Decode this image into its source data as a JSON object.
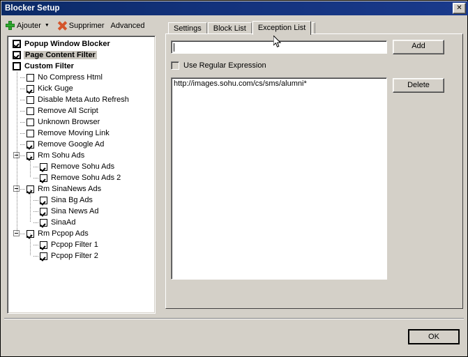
{
  "window": {
    "title": "Blocker Setup",
    "close_label": "✕"
  },
  "toolbar": {
    "add_label": "Ajouter",
    "add_caret": "▼",
    "remove_label": "Supprimer",
    "advanced_label": "Advanced"
  },
  "tree": {
    "nodes": [
      {
        "label": "Popup Window Blocker",
        "level": 0,
        "checked": true,
        "bold": true,
        "selected": false,
        "expander": false
      },
      {
        "label": "Page Content Filter",
        "level": 0,
        "checked": true,
        "bold": true,
        "selected": true,
        "expander": false
      },
      {
        "label": "Custom Filter",
        "level": 0,
        "checked": false,
        "bold": true,
        "selected": false,
        "expander": false
      },
      {
        "label": "No Compress Html",
        "level": 1,
        "checked": false,
        "bold": false,
        "selected": false,
        "expander": false
      },
      {
        "label": "Kick Guge",
        "level": 1,
        "checked": true,
        "bold": false,
        "selected": false,
        "expander": false
      },
      {
        "label": "Disable Meta Auto Refresh",
        "level": 1,
        "checked": false,
        "bold": false,
        "selected": false,
        "expander": false
      },
      {
        "label": "Remove All Script",
        "level": 1,
        "checked": false,
        "bold": false,
        "selected": false,
        "expander": false
      },
      {
        "label": "Unknown Browser",
        "level": 1,
        "checked": false,
        "bold": false,
        "selected": false,
        "expander": false
      },
      {
        "label": "Remove Moving Link",
        "level": 1,
        "checked": false,
        "bold": false,
        "selected": false,
        "expander": false
      },
      {
        "label": "Remove Google Ad",
        "level": 1,
        "checked": true,
        "bold": false,
        "selected": false,
        "expander": false
      },
      {
        "label": "Rm Sohu Ads",
        "level": 1,
        "checked": true,
        "bold": false,
        "selected": false,
        "expander": true
      },
      {
        "label": "Remove Sohu Ads",
        "level": 2,
        "checked": true,
        "bold": false,
        "selected": false,
        "expander": false
      },
      {
        "label": "Remove Sohu Ads 2",
        "level": 2,
        "checked": true,
        "bold": false,
        "selected": false,
        "expander": false
      },
      {
        "label": "Rm SinaNews Ads",
        "level": 1,
        "checked": true,
        "bold": false,
        "selected": false,
        "expander": true
      },
      {
        "label": "Sina Bg Ads",
        "level": 2,
        "checked": true,
        "bold": false,
        "selected": false,
        "expander": false
      },
      {
        "label": "Sina News Ad",
        "level": 2,
        "checked": true,
        "bold": false,
        "selected": false,
        "expander": false
      },
      {
        "label": "SinaAd",
        "level": 2,
        "checked": true,
        "bold": false,
        "selected": false,
        "expander": false
      },
      {
        "label": "Rm Pcpop Ads",
        "level": 1,
        "checked": true,
        "bold": false,
        "selected": false,
        "expander": true
      },
      {
        "label": "Pcpop Filter 1",
        "level": 2,
        "checked": true,
        "bold": false,
        "selected": false,
        "expander": false
      },
      {
        "label": "Pcpop Filter 2",
        "level": 2,
        "checked": true,
        "bold": false,
        "selected": false,
        "expander": false
      }
    ]
  },
  "tabs": [
    {
      "label": "Settings",
      "active": false
    },
    {
      "label": "Block List",
      "active": false
    },
    {
      "label": "Exception List",
      "active": true
    }
  ],
  "exception_panel": {
    "url_input_value": "",
    "url_input_placeholder": "",
    "add_label": "Add",
    "delete_label": "Delete",
    "regex_label": "Use Regular Expression",
    "regex_checked": false,
    "items": [
      "http://images.sohu.com/cs/sms/alumni*"
    ]
  },
  "footer": {
    "ok_label": "OK"
  },
  "colors": {
    "titlebar": "#12317a",
    "face": "#d4d0c8",
    "selection": "#c8c4bc",
    "add_icon": "#2faa2f",
    "remove_icon": "#d4542a"
  }
}
